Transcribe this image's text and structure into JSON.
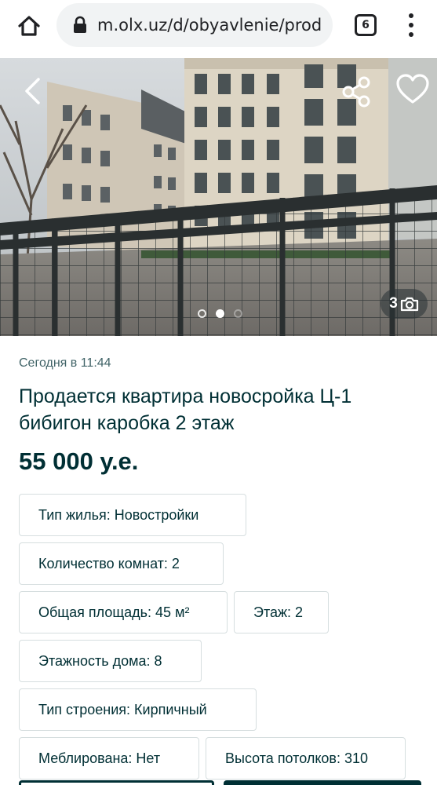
{
  "browser": {
    "url": "m.olx.uz/d/obyavlenie/prod",
    "tab_count": "6"
  },
  "gallery": {
    "photo_count": "3",
    "current_index": 2,
    "total_dots": 3
  },
  "listing": {
    "date": "Сегодня в 11:44",
    "title": "Продается квартира новосройка Ц-1 бибигон каробка 2 этаж",
    "price": "55 000 у.е."
  },
  "params": [
    "Тип жилья: Новостройки",
    "Количество комнат: 2",
    "Общая площадь: 45 м²",
    "Этаж: 2",
    "Этажность дома: 8",
    "Тип строения: Кирпичный",
    "Меблирована: Нет",
    "Высота потолков: 310"
  ],
  "colors": {
    "text_primary": "#002f34",
    "text_secondary": "#406367",
    "chip_border": "#d6dedf"
  }
}
